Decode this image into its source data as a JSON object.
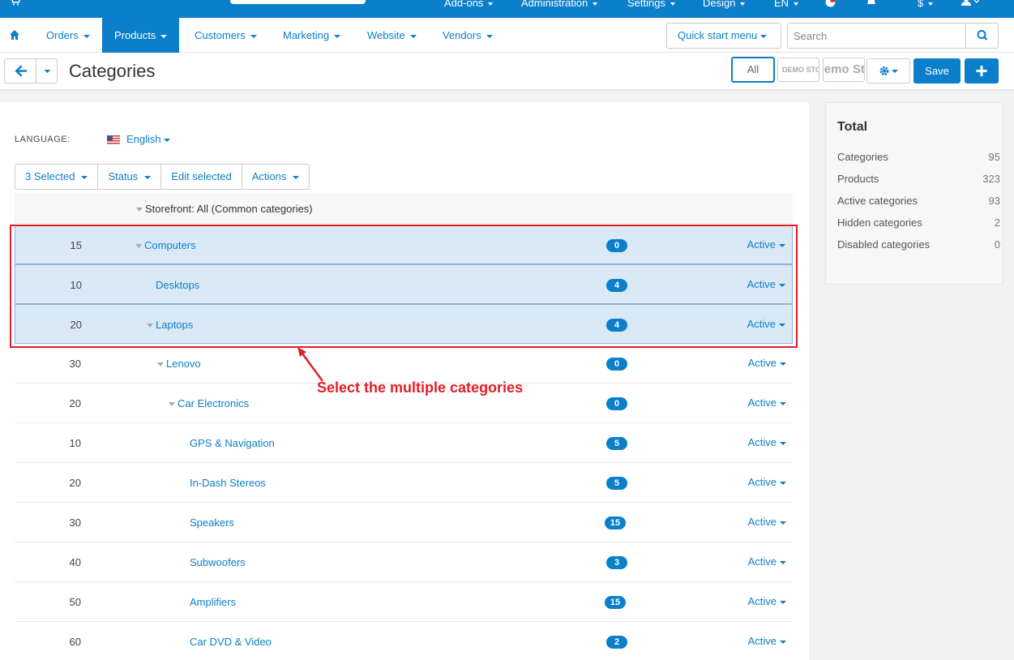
{
  "topbar": {
    "menus": [
      "Add-ons",
      "Administration",
      "Settings",
      "Design"
    ],
    "lang": "EN",
    "currency": "$"
  },
  "nav": {
    "items": [
      "Orders",
      "Products",
      "Customers",
      "Marketing",
      "Website",
      "Vendors"
    ],
    "active": "Products",
    "quick_start": "Quick start menu",
    "search_placeholder": "Search"
  },
  "header": {
    "title": "Categories",
    "all_label": "All",
    "store1": "DEMO STORE",
    "store2": "Demo Store",
    "save_label": "Save"
  },
  "language": {
    "label": "LANGUAGE:",
    "value": "English"
  },
  "toolbar": {
    "selected": "3 Selected",
    "status": "Status",
    "edit_selected": "Edit selected",
    "actions": "Actions"
  },
  "storefront": "Storefront: All (Common categories)",
  "categories": [
    {
      "position": "15",
      "name": "Computers",
      "count": "0",
      "status": "Active"
    },
    {
      "position": "10",
      "name": "Desktops",
      "count": "4",
      "status": "Active"
    },
    {
      "position": "20",
      "name": "Laptops",
      "count": "4",
      "status": "Active"
    },
    {
      "position": "30",
      "name": "Lenovo",
      "count": "0",
      "status": "Active"
    },
    {
      "position": "20",
      "name": "Car Electronics",
      "count": "0",
      "status": "Active"
    },
    {
      "position": "10",
      "name": "GPS & Navigation",
      "count": "5",
      "status": "Active"
    },
    {
      "position": "20",
      "name": "In-Dash Stereos",
      "count": "5",
      "status": "Active"
    },
    {
      "position": "30",
      "name": "Speakers",
      "count": "15",
      "status": "Active"
    },
    {
      "position": "40",
      "name": "Subwoofers",
      "count": "3",
      "status": "Active"
    },
    {
      "position": "50",
      "name": "Amplifiers",
      "count": "15",
      "status": "Active"
    },
    {
      "position": "60",
      "name": "Car DVD & Video",
      "count": "2",
      "status": "Active"
    }
  ],
  "annotation": "Select the multiple categories",
  "sidebar": {
    "title": "Total",
    "stats": [
      {
        "label": "Categories",
        "value": "95"
      },
      {
        "label": "Products",
        "value": "323"
      },
      {
        "label": "Active categories",
        "value": "93"
      },
      {
        "label": "Hidden categories",
        "value": "2"
      },
      {
        "label": "Disabled categories",
        "value": "0"
      }
    ]
  },
  "colors": {
    "accent": "#0b7fc9",
    "selected_row": "#dbe9f7",
    "annotation": "#e21f26"
  }
}
